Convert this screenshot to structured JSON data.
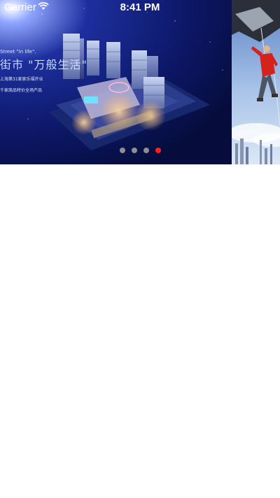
{
  "status_bar": {
    "carrier": "Carrier",
    "time": "8:41 PM"
  },
  "banner": {
    "slide_count": 4,
    "active_index": 3,
    "dot_inactive_color": "#8e8e93",
    "dot_active_color": "#ff1e1e",
    "current_slide": {
      "subtitle": "Street \"in life\".",
      "title": "街市 \"万般生活\"",
      "line1": "上海第31家家乐福开业",
      "line2": "千家商品特价全场产品"
    },
    "next_slide": {
      "icon": "climber-photo"
    }
  }
}
